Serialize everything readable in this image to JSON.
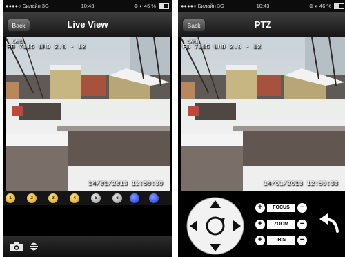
{
  "status_bar": {
    "carrier": "●●●●○ Билайн  3G",
    "time": "10:43",
    "right": "⊕ ◐ 46 %",
    "battery_level": 0.46
  },
  "left_screen": {
    "back_label": "Back",
    "title": "Live View",
    "camera_label": "CAM1",
    "camera_model": "FB 7115 LHD 2.8 - 12",
    "timestamp": "14/01/2013 12:50:30",
    "presets": [
      {
        "label": "1",
        "color": "yellow"
      },
      {
        "label": "2",
        "color": "yellow"
      },
      {
        "label": "3",
        "color": "yellow"
      },
      {
        "label": "4",
        "color": "yellow"
      },
      {
        "label": "5",
        "color": "gray"
      },
      {
        "label": "6",
        "color": "gray"
      },
      {
        "label": "",
        "color": "blue"
      },
      {
        "label": "",
        "color": "blue"
      }
    ],
    "toolbar": {
      "snapshot_icon": "camera-icon",
      "record_icon": "record-icon"
    }
  },
  "right_screen": {
    "back_label": "Back",
    "title": "PTZ",
    "camera_label": "CAM1",
    "camera_model": "FB 7115 LHD 2.8 - 12",
    "timestamp": "14/01/2013 12:50:33",
    "controls": {
      "focus_label": "FOCUS",
      "zoom_label": "ZOOM",
      "iris_label": "IRIS",
      "plus": "+",
      "minus": "−",
      "dpad_icon": "dpad-icon",
      "return_icon": "curved-arrow-icon"
    }
  }
}
